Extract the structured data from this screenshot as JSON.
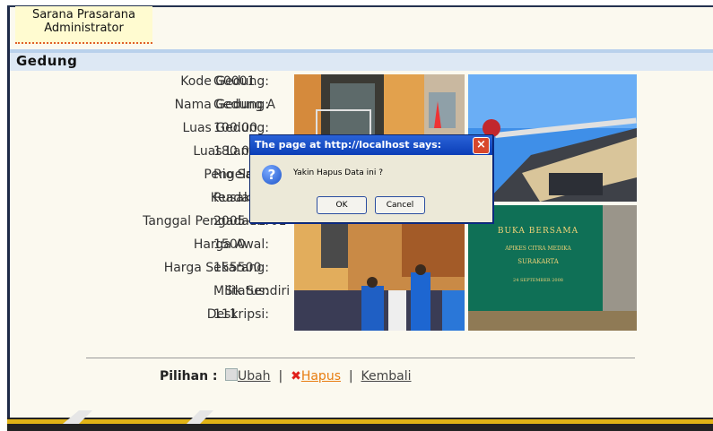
{
  "app": {
    "name_line1": "Sarana Prasarana",
    "name_line2": "Administrator"
  },
  "section": {
    "title": "Gedung"
  },
  "fields": [
    {
      "label": "Kode Gedung:",
      "value": "G0001"
    },
    {
      "label": "Nama Gedung:",
      "value": "Gedung A"
    },
    {
      "label": "Luas Gedung:",
      "value": "100.00"
    },
    {
      "label": "Luas Lantai:",
      "value": "180.00"
    },
    {
      "label": "Pengelola:",
      "value": "Rio Sa"
    },
    {
      "label": "Keadaan:",
      "value": "Rusak"
    },
    {
      "label": "Tanggal Pengadaan:",
      "value": "2005-01-01"
    },
    {
      "label": "Harga Awal:",
      "value": "1500"
    },
    {
      "label": "Harga Sekarang:",
      "value": "155500"
    },
    {
      "label": "Status:",
      "value": "Milik Sendiri"
    },
    {
      "label": "Deskripsi:",
      "value": "111"
    }
  ],
  "banner": {
    "line1": "BUKA BERSAMA",
    "line2": "APIKES CITRA MEDIKA",
    "line3": "SURAKARTA",
    "line4": "24 SEPTEMBER 2008"
  },
  "options": {
    "label": "Pilihan :",
    "edit": "Ubah",
    "delete": "Hapus",
    "back": "Kembali",
    "sep": "|"
  },
  "dialog": {
    "title": "The page at http://localhost says:",
    "message": "Yakin Hapus Data ini ?",
    "ok": "OK",
    "cancel": "Cancel",
    "close_symbol": "×",
    "icon_symbol": "?"
  }
}
